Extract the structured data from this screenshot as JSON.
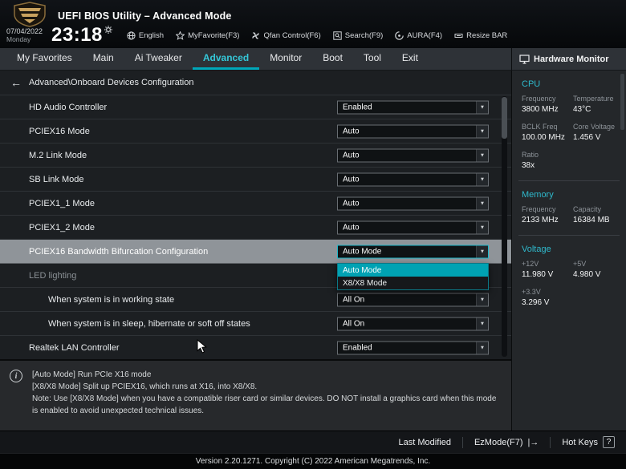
{
  "header": {
    "title": "UEFI BIOS Utility – Advanced Mode",
    "date": "07/04/2022",
    "day": "Monday",
    "time": "23:18",
    "toolbar": [
      {
        "label": "English"
      },
      {
        "label": "MyFavorite(F3)"
      },
      {
        "label": "Qfan Control(F6)"
      },
      {
        "label": "Search(F9)"
      },
      {
        "label": "AURA(F4)"
      },
      {
        "label": "Resize BAR"
      }
    ]
  },
  "menu": {
    "tabs": [
      "My Favorites",
      "Main",
      "Ai Tweaker",
      "Advanced",
      "Monitor",
      "Boot",
      "Tool",
      "Exit"
    ],
    "active_tab": "Advanced"
  },
  "breadcrumb": {
    "back_icon": "←",
    "path": "Advanced\\Onboard Devices Configuration"
  },
  "settings": [
    {
      "label": "HD Audio Controller",
      "value": "Enabled"
    },
    {
      "label": "PCIEX16 Mode",
      "value": "Auto"
    },
    {
      "label": "M.2 Link Mode",
      "value": "Auto"
    },
    {
      "label": "SB Link Mode",
      "value": "Auto"
    },
    {
      "label": "PCIEX1_1 Mode",
      "value": "Auto"
    },
    {
      "label": "PCIEX1_2 Mode",
      "value": "Auto"
    },
    {
      "label": "PCIEX16 Bandwidth Bifurcation Configuration",
      "value": "Auto Mode",
      "options": [
        "Auto Mode",
        "X8/X8 Mode"
      ],
      "selected_option": "Auto Mode"
    },
    {
      "label": "LED lighting"
    },
    {
      "label": "When system is in working state",
      "value": "All On"
    },
    {
      "label": "When system is in sleep, hibernate or soft off states",
      "value": "All On"
    },
    {
      "label": "Realtek LAN Controller",
      "value": "Enabled"
    }
  ],
  "hardware_monitor": {
    "title": "Hardware Monitor",
    "cpu": {
      "title": "CPU",
      "labels1": [
        "Frequency",
        "Temperature"
      ],
      "values1": [
        "3800 MHz",
        "43°C"
      ],
      "labels2": [
        "BCLK Freq",
        "Core Voltage"
      ],
      "values2": [
        "100.00 MHz",
        "1.456 V"
      ],
      "labels3": [
        "Ratio"
      ],
      "values3": [
        "38x"
      ]
    },
    "memory": {
      "title": "Memory",
      "labels1": [
        "Frequency",
        "Capacity"
      ],
      "values1": [
        "2133 MHz",
        "16384 MB"
      ]
    },
    "voltage": {
      "title": "Voltage",
      "labels1": [
        "+12V",
        "+5V"
      ],
      "values1": [
        "11.980 V",
        "4.980 V"
      ],
      "labels2": [
        "+3.3V"
      ],
      "values2": [
        "3.296 V"
      ]
    }
  },
  "help": {
    "icon": "i",
    "lines": [
      "[Auto Mode] Run PCIe X16 mode",
      "[X8/X8 Mode] Split up PCIEX16, which runs at X16, into X8/X8.",
      "Note: Use [X8/X8 Mode] when you have a compatible riser card or similar devices. DO NOT install a graphics card when this mode is enabled to avoid unexpected technical issues."
    ]
  },
  "bottom_bar": {
    "last_modified": "Last Modified",
    "ez_mode": "EzMode(F7)",
    "ez_mode_icon": "|→",
    "hot_keys": "Hot Keys",
    "hot_keys_icon": "?"
  },
  "footer": {
    "version": "Version 2.20.1271. Copyright (C) 2022 American Megatrends, Inc."
  },
  "colors": {
    "accent": "#2fc1d3",
    "highlight_row": "#8f9499",
    "dropdown_selected": "#00a2b3",
    "logo_gold": "#c9a25e"
  }
}
